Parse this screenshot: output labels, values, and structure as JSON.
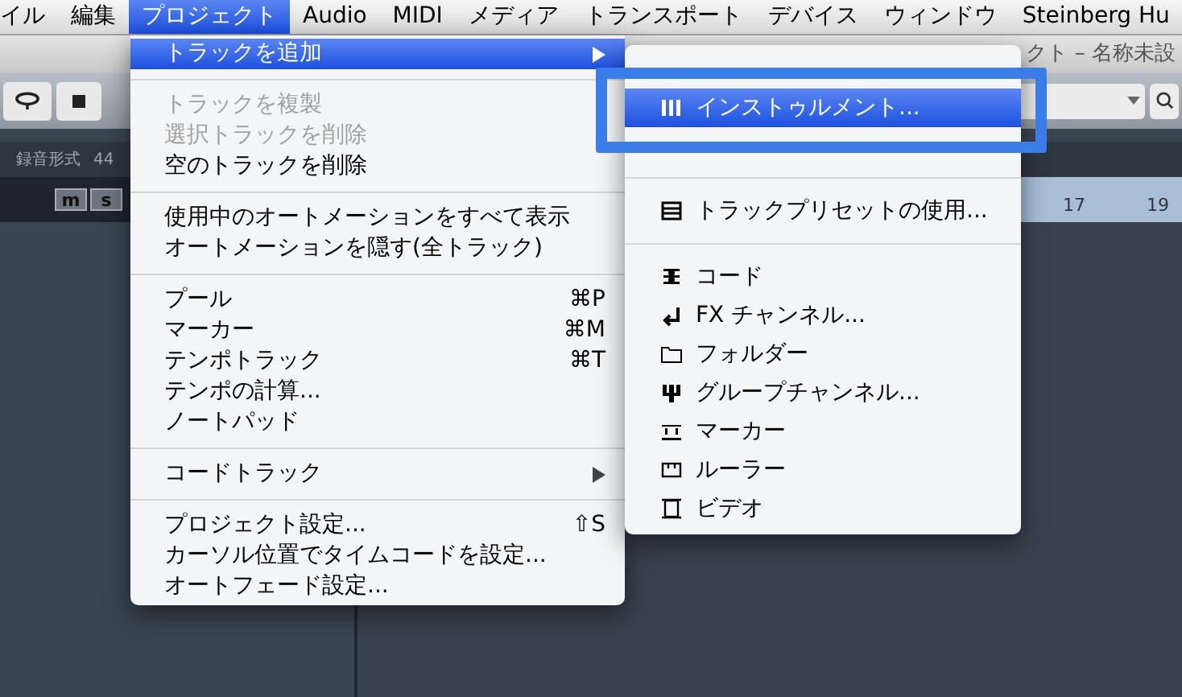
{
  "menu_bar": {
    "items": [
      {
        "label": "イル",
        "selected": false
      },
      {
        "label": "編集",
        "selected": false
      },
      {
        "label": "プロジェクト",
        "selected": true
      },
      {
        "label": "Audio",
        "selected": false
      },
      {
        "label": "MIDI",
        "selected": false
      },
      {
        "label": "メディア",
        "selected": false
      },
      {
        "label": "トランスポート",
        "selected": false
      },
      {
        "label": "デバイス",
        "selected": false
      },
      {
        "label": "ウィンドウ",
        "selected": false
      },
      {
        "label": "Steinberg Hu",
        "selected": false
      }
    ]
  },
  "window": {
    "title": "クト – 名称未設"
  },
  "info_line": {
    "label": "録音形式",
    "value": "44"
  },
  "track_buttons": [
    "m",
    "s"
  ],
  "ruler": {
    "labels": [
      "17",
      "19"
    ]
  },
  "project_menu": {
    "items": [
      {
        "kind": "item",
        "label": "トラックを追加",
        "selected": true,
        "disabled": false,
        "submenu": true
      },
      {
        "kind": "separator"
      },
      {
        "kind": "item",
        "label": "トラックを複製",
        "selected": false,
        "disabled": true,
        "submenu": false
      },
      {
        "kind": "item",
        "label": "選択トラックを削除",
        "selected": false,
        "disabled": true,
        "submenu": false
      },
      {
        "kind": "item",
        "label": "空のトラックを削除",
        "selected": false,
        "disabled": false,
        "submenu": false
      },
      {
        "kind": "separator"
      },
      {
        "kind": "item",
        "label": "使用中のオートメーションをすべて表示",
        "selected": false,
        "disabled": false,
        "submenu": false
      },
      {
        "kind": "item",
        "label": "オートメーションを隠す(全トラック)",
        "selected": false,
        "disabled": false,
        "submenu": false
      },
      {
        "kind": "separator"
      },
      {
        "kind": "item",
        "label": "プール",
        "shortcut": "⌘P",
        "selected": false,
        "disabled": false,
        "submenu": false
      },
      {
        "kind": "item",
        "label": "マーカー",
        "shortcut": "⌘M",
        "selected": false,
        "disabled": false,
        "submenu": false
      },
      {
        "kind": "item",
        "label": "テンポトラック",
        "shortcut": "⌘T",
        "selected": false,
        "disabled": false,
        "submenu": false
      },
      {
        "kind": "item",
        "label": "テンポの計算...",
        "selected": false,
        "disabled": false,
        "submenu": false
      },
      {
        "kind": "item",
        "label": "ノートパッド",
        "selected": false,
        "disabled": false,
        "submenu": false
      },
      {
        "kind": "separator"
      },
      {
        "kind": "item",
        "label": "コードトラック",
        "selected": false,
        "disabled": false,
        "submenu": true
      },
      {
        "kind": "separator"
      },
      {
        "kind": "item",
        "label": "プロジェクト設定...",
        "shortcut": "⇧S",
        "selected": false,
        "disabled": false,
        "submenu": false
      },
      {
        "kind": "item",
        "label": "カーソル位置でタイムコードを設定...",
        "selected": false,
        "disabled": false,
        "submenu": false
      },
      {
        "kind": "item",
        "label": "オートフェード設定...",
        "selected": false,
        "disabled": false,
        "submenu": false
      }
    ]
  },
  "add_track_submenu": {
    "items": [
      {
        "kind": "hidden"
      },
      {
        "kind": "item",
        "label": "インストゥルメント...",
        "selected": true
      },
      {
        "kind": "hidden"
      },
      {
        "kind": "separator"
      },
      {
        "kind": "item",
        "label": "トラックプリセットの使用...",
        "selected": false
      },
      {
        "kind": "separator"
      },
      {
        "kind": "item",
        "label": "コード",
        "selected": false
      },
      {
        "kind": "item",
        "label": "FX チャンネル...",
        "selected": false
      },
      {
        "kind": "item",
        "label": "フォルダー",
        "selected": false
      },
      {
        "kind": "item",
        "label": "グループチャンネル...",
        "selected": false
      },
      {
        "kind": "item",
        "label": "マーカー",
        "selected": false
      },
      {
        "kind": "item",
        "label": "ルーラー",
        "selected": false
      },
      {
        "kind": "item",
        "label": "ビデオ",
        "selected": false
      }
    ]
  }
}
